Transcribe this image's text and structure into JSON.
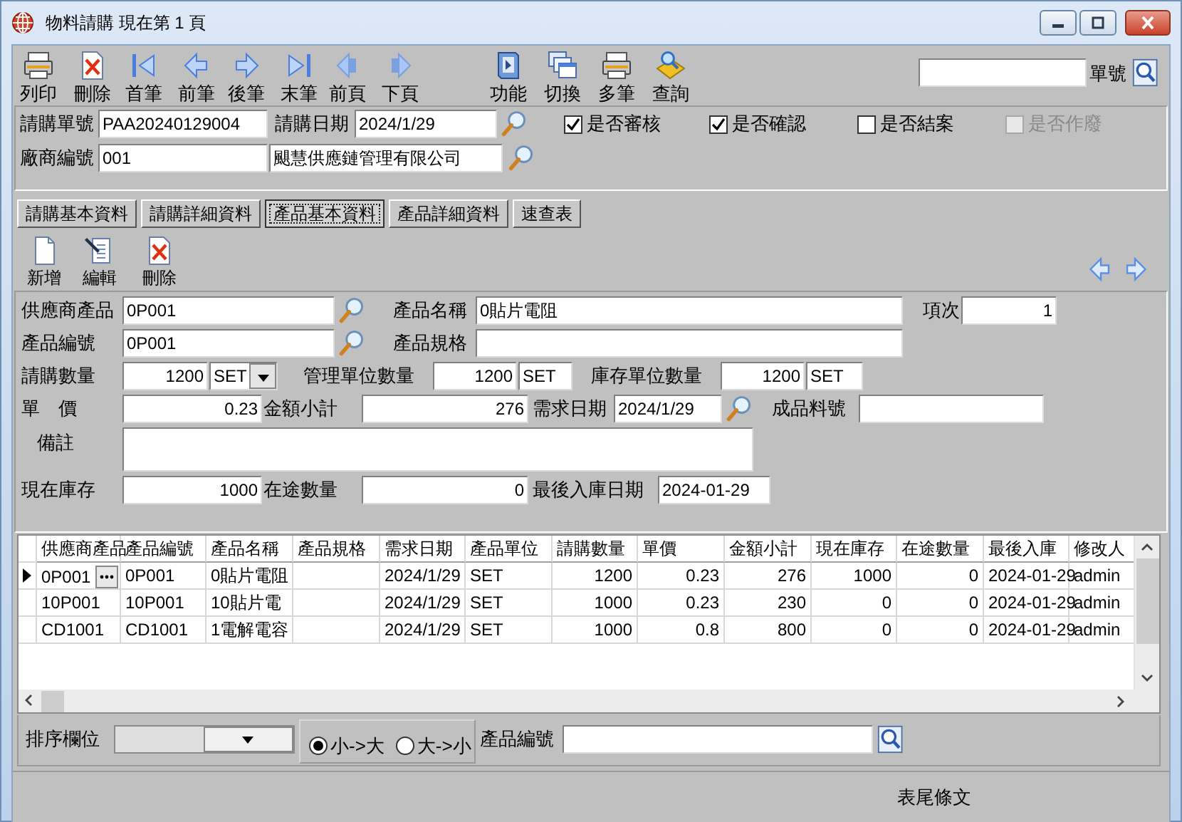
{
  "window": {
    "title": "物料請購  現在第 1 頁"
  },
  "toolbar": {
    "buttons": [
      {
        "kind": "print",
        "label": "列印"
      },
      {
        "kind": "delete",
        "label": "刪除"
      },
      {
        "kind": "first",
        "label": "首筆"
      },
      {
        "kind": "previous",
        "label": "前筆"
      },
      {
        "kind": "next",
        "label": "後筆"
      },
      {
        "kind": "last",
        "label": "末筆"
      },
      {
        "kind": "previous-page",
        "label": "前頁"
      },
      {
        "kind": "next-page",
        "label": "下頁"
      },
      {
        "kind": "function",
        "label": "功能"
      },
      {
        "kind": "switch",
        "label": "切換"
      },
      {
        "kind": "multi",
        "label": "多筆"
      },
      {
        "kind": "query",
        "label": "查詢"
      }
    ],
    "search_label": "單號"
  },
  "header": {
    "request_no": {
      "label": "請購單號",
      "value": "PAA20240129004"
    },
    "request_date": {
      "label": "請購日期",
      "value": "2024/1/29"
    },
    "vendor": {
      "label": "廠商編號",
      "value": "001",
      "name": "颶慧供應鏈管理有限公司"
    },
    "flags": [
      {
        "label": "是否審核",
        "checked": true,
        "disabled": false
      },
      {
        "label": "是否確認",
        "checked": true,
        "disabled": false
      },
      {
        "label": "是否結案",
        "checked": false,
        "disabled": false
      },
      {
        "label": "是否作廢",
        "checked": false,
        "disabled": true
      }
    ]
  },
  "tabs": [
    {
      "label": "請購基本資料",
      "selected": false
    },
    {
      "label": "請購詳細資料",
      "selected": false
    },
    {
      "label": "產品基本資料",
      "selected": true
    },
    {
      "label": "產品詳細資料",
      "selected": false
    },
    {
      "label": "速查表",
      "selected": false
    }
  ],
  "item_toolbar": {
    "buttons": [
      {
        "kind": "new",
        "label": "新增"
      },
      {
        "kind": "edit",
        "label": "編輯"
      },
      {
        "kind": "delete",
        "label": "刪除"
      }
    ]
  },
  "item": {
    "supplier_product": {
      "label": "供應商產品",
      "value": "0P001"
    },
    "product_name": {
      "label": "產品名稱",
      "value": "0貼片電阻"
    },
    "line_no": {
      "label": "項次",
      "value": "1"
    },
    "product_no": {
      "label": "產品編號",
      "value": "0P001"
    },
    "product_spec": {
      "label": "產品規格"
    },
    "quantity": {
      "label": "請購數量",
      "value": "1200",
      "unit": "SET"
    },
    "mgmt_qty": {
      "label": "管理單位數量",
      "value": "1200",
      "unit": "SET"
    },
    "stock_qty": {
      "label": "庫存單位數量",
      "value": "1200",
      "unit": "SET"
    },
    "unit_price": {
      "label": "單　價",
      "value": "0.23"
    },
    "subtotal": {
      "label": "金額小計",
      "value": "276"
    },
    "due_date": {
      "label": "需求日期",
      "value": "2024/1/29"
    },
    "finished_no": {
      "label": "成品料號"
    },
    "note": {
      "label": "備註"
    },
    "on_hand": {
      "label": "現在庫存",
      "value": "1000"
    },
    "in_transit": {
      "label": "在途數量",
      "value": "0"
    },
    "last_receipt": {
      "label": "最後入庫日期",
      "value": "2024-01-29"
    }
  },
  "grid": {
    "columns": [
      "供應商產品",
      "產品編號",
      "產品名稱",
      "產品規格",
      "需求日期",
      "產品單位",
      "請購數量",
      "單價",
      "金額小計",
      "現在庫存",
      "在途數量",
      "最後入庫",
      "修改人"
    ],
    "rows": [
      {
        "selected": true,
        "cells": [
          "0P001",
          "0P001",
          "0貼片電阻",
          null,
          "2024/1/29",
          "SET",
          "1200",
          "0.23",
          "276",
          "1000",
          "0",
          "2024-01-29",
          "admin"
        ]
      },
      {
        "selected": false,
        "cells": [
          "10P001",
          "10P001",
          "10貼片電",
          null,
          "2024/1/29",
          "SET",
          "1000",
          "0.23",
          "230",
          "0",
          "0",
          "2024-01-29",
          "admin"
        ]
      },
      {
        "selected": false,
        "cells": [
          "CD1001",
          "CD1001",
          "1電解電容",
          null,
          "2024/1/29",
          "SET",
          "1000",
          "0.8",
          "800",
          "0",
          "0",
          "2024-01-29",
          "admin"
        ]
      }
    ]
  },
  "sort_bar": {
    "label": "排序欄位",
    "order": [
      {
        "label": "小->大",
        "selected": true
      },
      {
        "label": "大->小",
        "selected": false
      }
    ],
    "search_label": "產品編號"
  },
  "footer": {
    "text": "表尾條文"
  }
}
